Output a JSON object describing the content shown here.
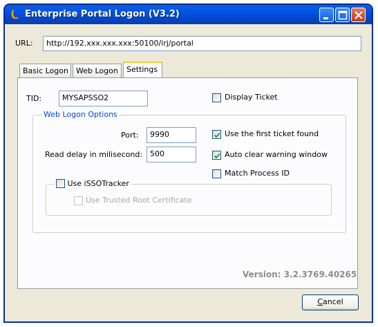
{
  "window": {
    "title": "Enterprise Portal Logon (V3.2)"
  },
  "url": {
    "label": "URL:",
    "value": "http://192.xxx.xxx.xxx:50100/irj/portal"
  },
  "tabs": [
    {
      "label": "Basic Logon",
      "active": false
    },
    {
      "label": "Web Logon",
      "active": false
    },
    {
      "label": "Settings",
      "active": true
    }
  ],
  "settings": {
    "tid_label": "TID:",
    "tid_value": "MYSAPSSO2",
    "display_ticket": {
      "label": "Display Ticket",
      "checked": false
    },
    "web_logon_group": "Web Logon Options",
    "port_label": "Port:",
    "port_value": "9990",
    "read_delay_label": "Read delay in milisecond:",
    "read_delay_value": "500",
    "use_first_ticket": {
      "label": "Use the first ticket found",
      "checked": true
    },
    "auto_clear": {
      "label": "Auto clear warning window",
      "checked": true
    },
    "match_process": {
      "label": "Match Process ID",
      "checked": false
    },
    "isso_tracker": {
      "label": "Use iSSOTracker",
      "checked": false
    },
    "trusted_root": {
      "label": "Use Trusted Root Certificate",
      "checked": false,
      "enabled": false
    }
  },
  "version": "Version: 3.2.3769.40265",
  "cancel_button": {
    "prefix": "",
    "mnemonic": "C",
    "rest": "ancel"
  }
}
